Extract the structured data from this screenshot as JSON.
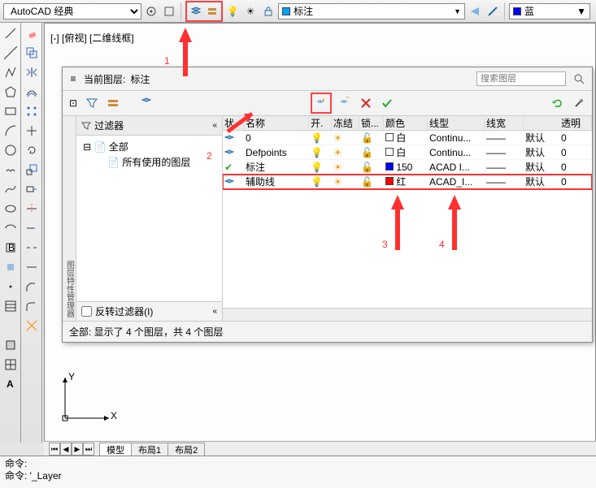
{
  "topbar": {
    "workspace": "AutoCAD 经典",
    "layer_combo": {
      "name": "标注",
      "color": "#00a0ff"
    },
    "color_combo": {
      "label": "蓝",
      "hex": "#0000ff"
    }
  },
  "viewport_label": "[-] [俯视] [二维线框]",
  "layer_dialog": {
    "current_label": "当前图层:",
    "current_layer": "标注",
    "search_placeholder": "搜索图层",
    "filter_header": "过滤器",
    "tree_root": "全部",
    "tree_child": "所有使用的图层",
    "invert_label": "反转过滤器(I)",
    "status": "全部: 显示了 4 个图层，共 4 个图层",
    "columns": [
      "状",
      "名称",
      "开.",
      "冻结",
      "锁...",
      "颜色",
      "线型",
      "线宽",
      "",
      "透明"
    ],
    "rows": [
      {
        "state": "",
        "name": "0",
        "on": "💡",
        "freeze": "☀",
        "lock": "🔓",
        "color_hex": "#ffffff",
        "color_name": "白",
        "linetype": "Continu...",
        "lw_glyph": "——",
        "lw_text": "默认",
        "trans": "0",
        "hl": false
      },
      {
        "state": "",
        "name": "Defpoints",
        "on": "💡",
        "freeze": "☀",
        "lock": "🔓",
        "color_hex": "#ffffff",
        "color_name": "白",
        "linetype": "Continu...",
        "lw_glyph": "——",
        "lw_text": "默认",
        "trans": "0",
        "hl": false
      },
      {
        "state": "✔",
        "name": "标注",
        "on": "💡",
        "freeze": "☀",
        "lock": "🔓",
        "color_hex": "#0000ff",
        "color_name": "150",
        "linetype": "ACAD I...",
        "lw_glyph": "——",
        "lw_text": "默认",
        "trans": "0",
        "hl": false
      },
      {
        "state": "",
        "name": "辅助线",
        "on": "💡",
        "freeze": "☀",
        "lock": "🔓",
        "color_hex": "#ff0000",
        "color_name": "红",
        "linetype": "ACAD_I...",
        "lw_glyph": "——",
        "lw_text": "默认",
        "trans": "0",
        "hl": true
      }
    ]
  },
  "tabs": {
    "nav": [
      "⏮",
      "◀",
      "▶",
      "⏭"
    ],
    "items": [
      "模型",
      "布局1",
      "布局2"
    ]
  },
  "command": {
    "line1": "命令:",
    "line2": "命令: '_Layer"
  },
  "axes": {
    "x": "X",
    "y": "Y"
  },
  "annotations": {
    "n1": "1",
    "n2": "2",
    "n3": "3",
    "n4": "4"
  },
  "chart_data": null
}
